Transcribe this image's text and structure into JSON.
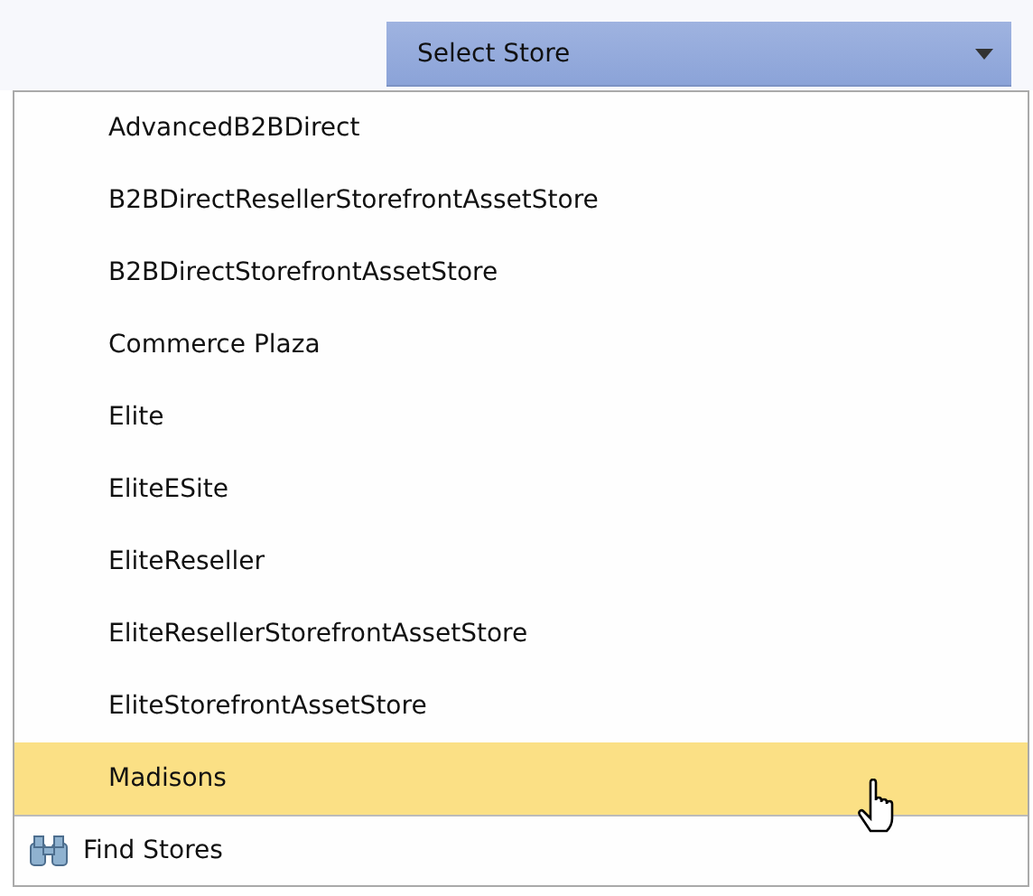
{
  "select": {
    "label": "Select Store"
  },
  "stores": [
    {
      "label": "AdvancedB2BDirect",
      "selected": false
    },
    {
      "label": "B2BDirectResellerStorefrontAssetStore",
      "selected": false
    },
    {
      "label": "B2BDirectStorefrontAssetStore",
      "selected": false
    },
    {
      "label": "Commerce Plaza",
      "selected": false
    },
    {
      "label": "Elite",
      "selected": false
    },
    {
      "label": "EliteESite",
      "selected": false
    },
    {
      "label": "EliteReseller",
      "selected": false
    },
    {
      "label": "EliteResellerStorefrontAssetStore",
      "selected": false
    },
    {
      "label": "EliteStorefrontAssetStore",
      "selected": false
    },
    {
      "label": "Madisons",
      "selected": true
    }
  ],
  "find": {
    "label": "Find Stores"
  }
}
